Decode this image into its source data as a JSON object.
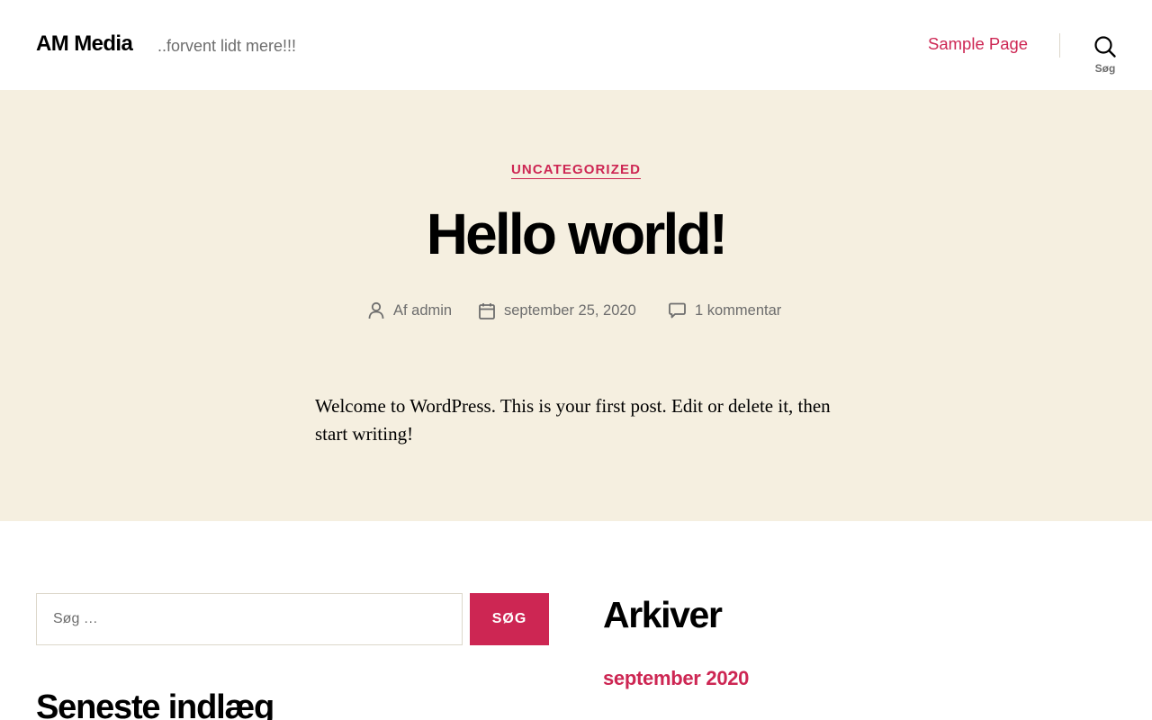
{
  "header": {
    "site_title": "AM Media",
    "site_description": "..forvent lidt mere!!!",
    "nav_items": [
      {
        "label": "Sample Page"
      }
    ],
    "search_toggle_label": "Søg"
  },
  "post": {
    "category": "UNCATEGORIZED",
    "title": "Hello world!",
    "meta": {
      "author": "Af admin",
      "date": "september 25, 2020",
      "comments": "1 kommentar"
    },
    "content": "Welcome to WordPress. This is your first post. Edit or delete it, then start writing!"
  },
  "widgets": {
    "search": {
      "placeholder": "Søg …",
      "submit_label": "SØG"
    },
    "recent_posts_title": "Seneste indlæg",
    "archives_title": "Arkiver",
    "archives": [
      {
        "label": "september 2020"
      }
    ]
  },
  "colors": {
    "accent": "#cd2653",
    "band_background": "#f5efe0",
    "secondary_text": "#6d6d6d",
    "border": "#dcd7ca"
  },
  "icons": {
    "search": "search-icon",
    "author": "user-icon",
    "date": "calendar-icon",
    "comments": "comment-icon"
  }
}
